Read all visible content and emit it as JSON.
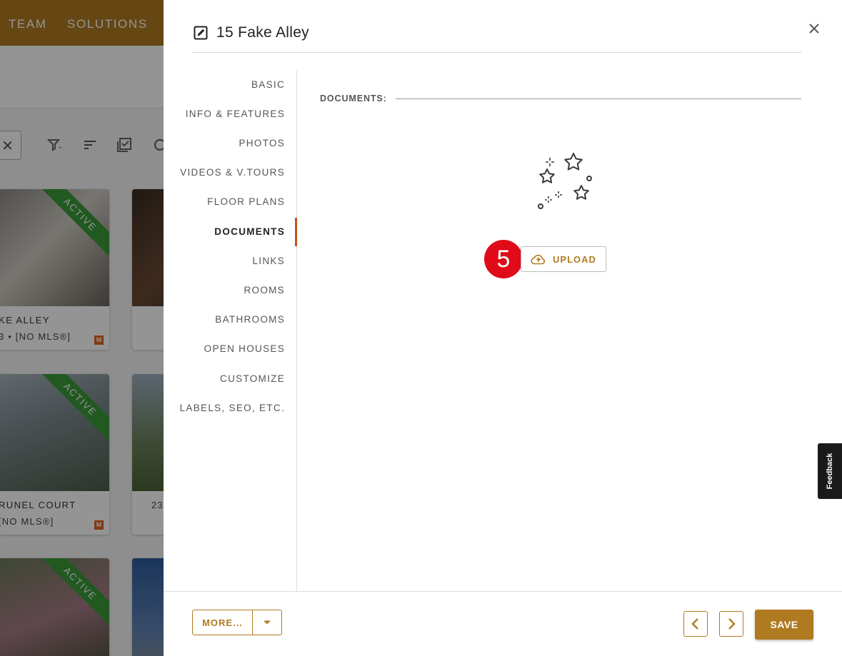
{
  "background": {
    "nav_items": [
      "TEAM",
      "SOLUTIONS"
    ],
    "cards": [
      {
        "status": "ACTIVE",
        "line1": "KE ALLEY",
        "line2": "3 • [NO MLS®]",
        "badge": "M"
      },
      {
        "status": "ACTIVE",
        "line1": "RUNEL COURT",
        "line2": " [NO MLS®]",
        "badge": "M"
      },
      {
        "status": "ACTIVE",
        "line1": "",
        "line2": "",
        "badge": ""
      },
      {
        "status": "",
        "line1": "",
        "line2": "",
        "badge": ""
      },
      {
        "status": "",
        "line1": "",
        "line2": "23",
        "badge": ""
      },
      {
        "status": "",
        "line1": "",
        "line2": "",
        "badge": ""
      }
    ]
  },
  "drawer": {
    "title": "15 Fake Alley",
    "title_icon": "edit-icon",
    "close_icon": "close-icon",
    "tabs": [
      {
        "label": "BASIC",
        "active": false
      },
      {
        "label": "INFO & FEATURES",
        "active": false
      },
      {
        "label": "PHOTOS",
        "active": false
      },
      {
        "label": "VIDEOS & V.TOURS",
        "active": false
      },
      {
        "label": "FLOOR PLANS",
        "active": false
      },
      {
        "label": "DOCUMENTS",
        "active": true
      },
      {
        "label": "LINKS",
        "active": false
      },
      {
        "label": "ROOMS",
        "active": false
      },
      {
        "label": "BATHROOMS",
        "active": false
      },
      {
        "label": "OPEN HOUSES",
        "active": false
      },
      {
        "label": "CUSTOMIZE",
        "active": false
      },
      {
        "label": "LABELS, SEO, ETC.",
        "active": false
      }
    ],
    "section_label": "DOCUMENTS:",
    "empty_icon": "stars-icon",
    "step_badge": "5",
    "upload": {
      "label": "UPLOAD",
      "icon": "cloud-upload-icon"
    },
    "footer": {
      "more_label": "MORE...",
      "dropdown_icon": "caret-down-icon",
      "prev_icon": "chevron-left-icon",
      "next_icon": "chevron-right-icon",
      "save_label": "SAVE"
    }
  },
  "feedback_label": "Feedback",
  "colors": {
    "accent": "#b07a21",
    "active_indicator": "#c0541f",
    "step_badge": "#e00a18",
    "ribbon": "#3b9a3a"
  }
}
